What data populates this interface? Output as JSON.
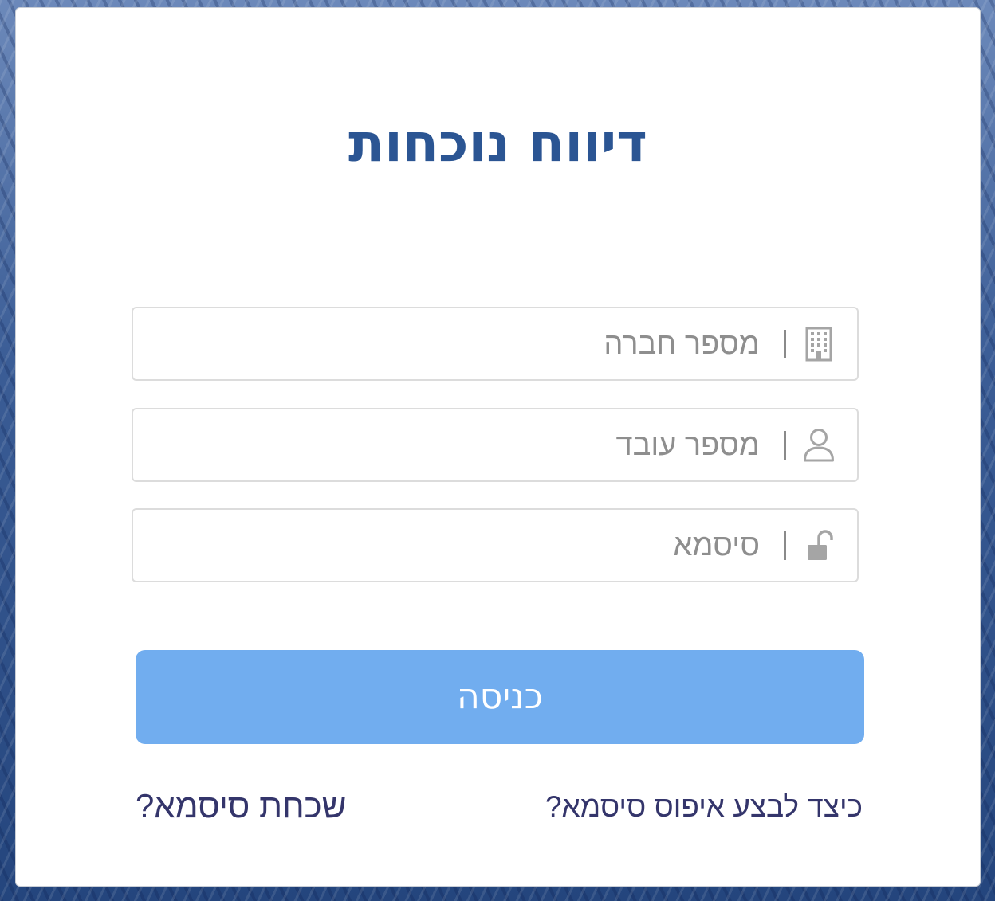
{
  "login": {
    "title": "דיווח נוכחות",
    "company_field": {
      "placeholder": "מספר חברה",
      "icon": "building-icon"
    },
    "employee_field": {
      "placeholder": "מספר עובד",
      "icon": "user-icon"
    },
    "password_field": {
      "placeholder": "סיסמא",
      "icon": "unlocked-padlock-icon"
    },
    "submit_label": "כניסה",
    "reset_help_link": "כיצד לבצע איפוס סיסמא?",
    "forgot_password_link": "שכחת סיסמא?"
  },
  "colors": {
    "title": "#2b5593",
    "button": "#71adef",
    "links": "#34356b",
    "icons": "#a5a5a5"
  }
}
